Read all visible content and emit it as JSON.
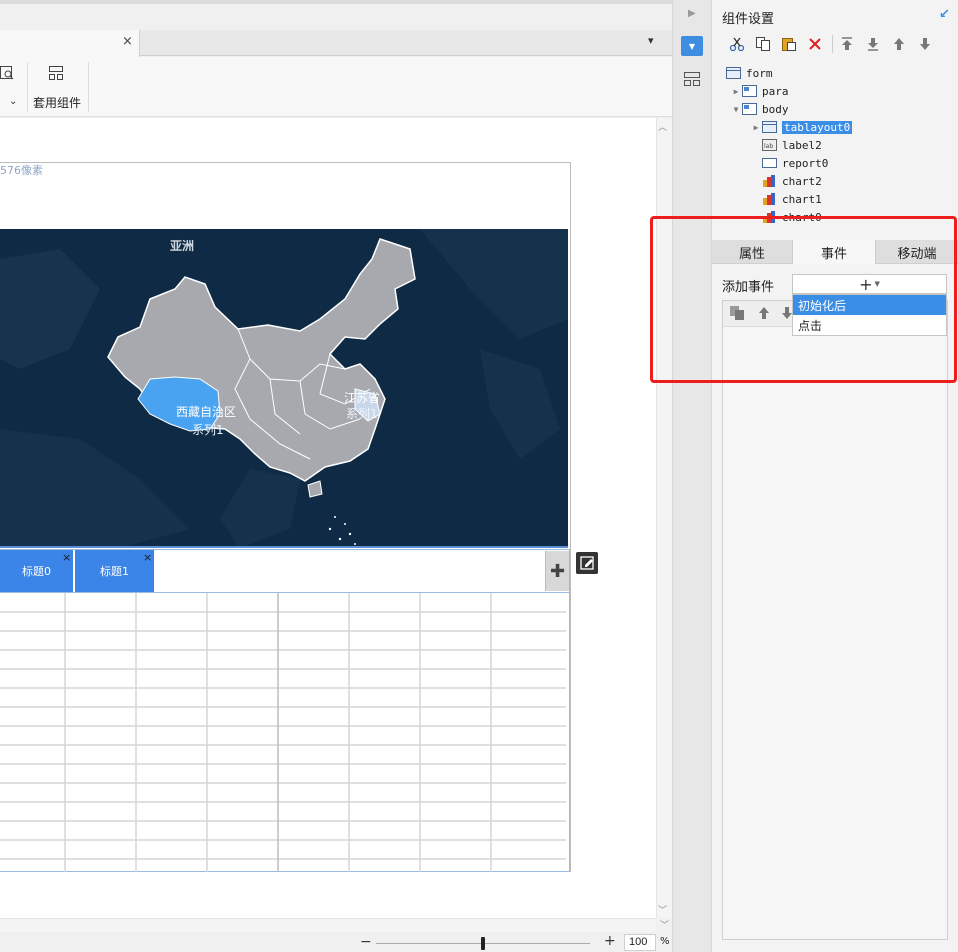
{
  "designer": {
    "tab_close": "×",
    "tab_menu": "▾",
    "toolbar": {
      "apply_widget_label": "套用组件",
      "dropdown_chevron": "⌄"
    },
    "canvas": {
      "size_label": "576像素",
      "map": {
        "region_label": "亚洲",
        "labels": [
          {
            "name": "西藏自治区",
            "series": "系列1"
          },
          {
            "name": "江苏省",
            "series": "系列1"
          }
        ],
        "colors": {
          "sea": "#0e2a44",
          "land": "#a7a9ae",
          "highlight": "#4aa3f0"
        }
      },
      "tab_widget": {
        "tabs": [
          {
            "label": "标题0",
            "close": "×"
          },
          {
            "label": "标题1",
            "close": "×"
          }
        ],
        "add_symbol": "✚"
      },
      "grid": {
        "rows": 15,
        "cols": 8
      }
    },
    "zoom": {
      "minus": "−",
      "plus": "+",
      "value": "100",
      "unit": "%",
      "level": 0.5
    }
  },
  "side_strip": {
    "collapse_arrow": "▶",
    "settings_glyph": "▼"
  },
  "panel": {
    "title": "组件设置",
    "corner_glyph": "↙",
    "toolbar_icons": [
      "cut-icon",
      "copy-icon",
      "paste-icon",
      "delete-icon",
      "move-top-icon",
      "move-bottom-icon",
      "move-up-icon",
      "move-down-icon"
    ],
    "tree": [
      {
        "label": "form",
        "depth": 0,
        "toggle": "",
        "icon": "form"
      },
      {
        "label": "para",
        "depth": 1,
        "toggle": "▶",
        "icon": "layout"
      },
      {
        "label": "body",
        "depth": 1,
        "toggle": "▼",
        "icon": "layout"
      },
      {
        "label": "tablayout0",
        "depth": 2,
        "toggle": "▶",
        "icon": "form",
        "selected": true
      },
      {
        "label": "label2",
        "depth": 2,
        "toggle": "",
        "icon": "label"
      },
      {
        "label": "report0",
        "depth": 2,
        "toggle": "",
        "icon": "report"
      },
      {
        "label": "chart2",
        "depth": 2,
        "toggle": "",
        "icon": "chart"
      },
      {
        "label": "chart1",
        "depth": 2,
        "toggle": "",
        "icon": "chart"
      },
      {
        "label": "chart0",
        "depth": 2,
        "toggle": "",
        "icon": "chart"
      }
    ],
    "tabs": [
      "属性",
      "事件",
      "移动端"
    ],
    "add_event_label": "添加事件",
    "add_button": "+",
    "dropdown_items": [
      "初始化后",
      "点击"
    ]
  }
}
